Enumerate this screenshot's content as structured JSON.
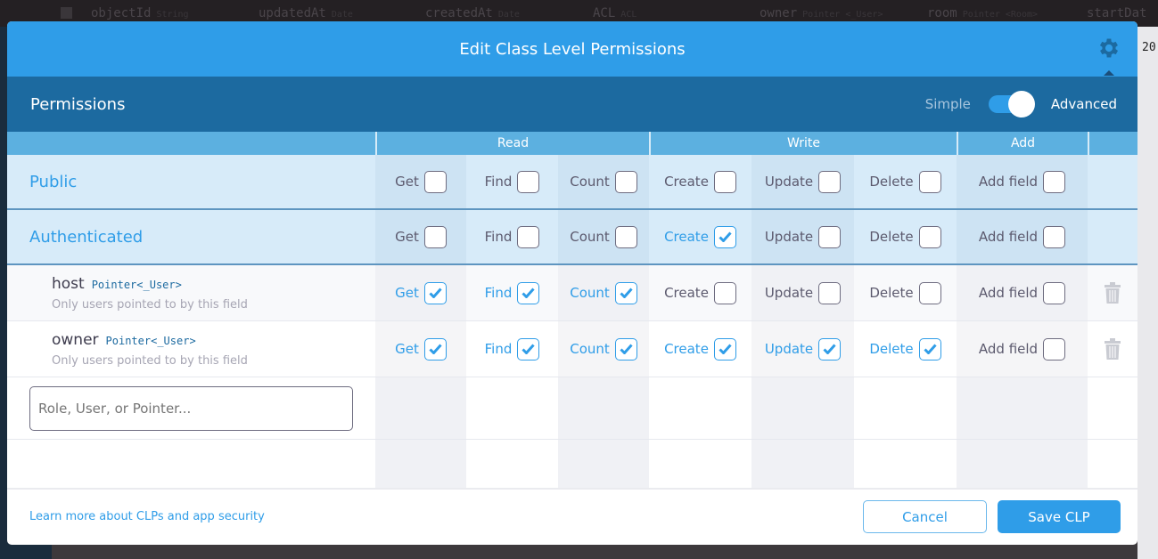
{
  "background": {
    "columns": [
      {
        "name": "objectId",
        "type": "String"
      },
      {
        "name": "updatedAt",
        "type": "Date"
      },
      {
        "name": "createdAt",
        "type": "Date"
      },
      {
        "name": "ACL",
        "type": "ACL"
      },
      {
        "name": "owner",
        "type": "Pointer <_User>"
      },
      {
        "name": "room",
        "type": "Pointer <Room>"
      },
      {
        "name": "startDat",
        "type": ""
      }
    ],
    "cell_value": "20"
  },
  "modal": {
    "title": "Edit Class Level Permissions",
    "gear_icon": "gear-icon",
    "permissions_label": "Permissions",
    "mode": {
      "simple": "Simple",
      "advanced": "Advanced",
      "selected": "Advanced"
    },
    "groups": [
      "Read",
      "Write",
      "Add"
    ],
    "perm_labels": [
      "Get",
      "Find",
      "Count",
      "Create",
      "Update",
      "Delete",
      "Add field"
    ],
    "rows": [
      {
        "kind": "public",
        "label": "Public",
        "perms": [
          false,
          false,
          false,
          false,
          false,
          false,
          false
        ]
      },
      {
        "kind": "public",
        "label": "Authenticated",
        "perms": [
          false,
          false,
          false,
          true,
          false,
          false,
          false
        ]
      },
      {
        "kind": "field",
        "label": "host",
        "type": "Pointer<_User>",
        "subtitle": "Only users pointed to by this field",
        "perms": [
          true,
          true,
          true,
          false,
          false,
          false,
          false
        ]
      },
      {
        "kind": "field",
        "label": "owner",
        "type": "Pointer<_User>",
        "subtitle": "Only users pointed to by this field",
        "perms": [
          true,
          true,
          true,
          true,
          true,
          true,
          false
        ]
      }
    ],
    "input_placeholder": "Role, User, or Pointer...",
    "learn_link": "Learn more about CLPs and app security",
    "cancel": "Cancel",
    "save": "Save CLP",
    "accent": "#2f9de8"
  }
}
